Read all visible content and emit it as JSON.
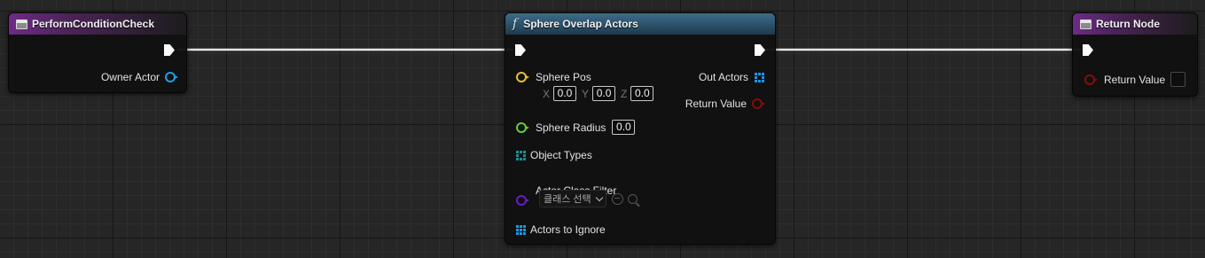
{
  "colors": {
    "exec": "#fafafa",
    "object_pin": "#1ea0e6",
    "vector_pin": "#e8c02a",
    "float_pin": "#5ecf38",
    "class_pin": "#6b1cbf",
    "bool_pin": "#8b0b0b",
    "array_pin": "#1a98e6",
    "object_types_pin": "#1f8e96"
  },
  "nodes": {
    "perform": {
      "title": "PerformConditionCheck",
      "owner_actor_label": "Owner Actor"
    },
    "sphere": {
      "title": "Sphere Overlap Actors",
      "function_icon": "f",
      "sphere_pos_label": "Sphere Pos",
      "x_label": "X",
      "x_value": "0.0",
      "y_label": "Y",
      "y_value": "0.0",
      "z_label": "Z",
      "z_value": "0.0",
      "sphere_radius_label": "Sphere Radius",
      "sphere_radius_value": "0.0",
      "object_types_label": "Object Types",
      "actor_class_filter_label": "Actor Class Filter",
      "actor_class_dropdown": "클래스 선택",
      "actors_to_ignore_label": "Actors to Ignore",
      "out_actors_label": "Out Actors",
      "return_value_label": "Return Value"
    },
    "return": {
      "title": "Return Node",
      "return_value_label": "Return Value"
    }
  }
}
